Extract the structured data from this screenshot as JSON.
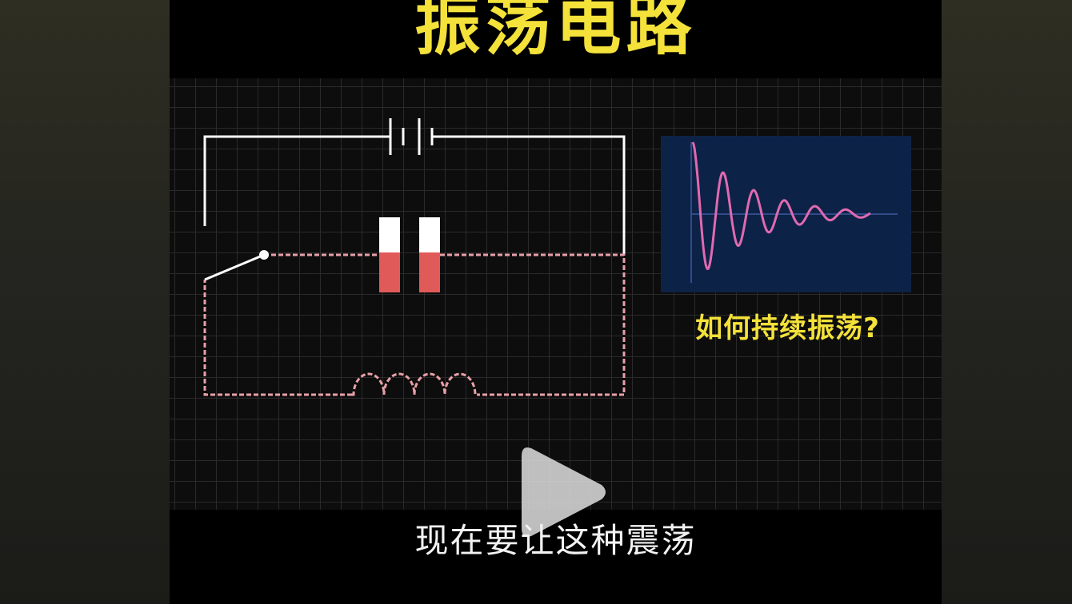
{
  "video": {
    "title": "振荡电路",
    "question": "如何持续振荡?",
    "subtitle": "现在要让这种震荡",
    "play_icon": "play-icon"
  },
  "colors": {
    "title": "#f4e23a",
    "wire": "#ffffff",
    "charge_wire": "#e8a0a8",
    "capacitor_charge": "#e05a5a",
    "wave_panel": "#0d2247",
    "wave_line": "#e06ab0",
    "grid": "#2a2a2a"
  }
}
